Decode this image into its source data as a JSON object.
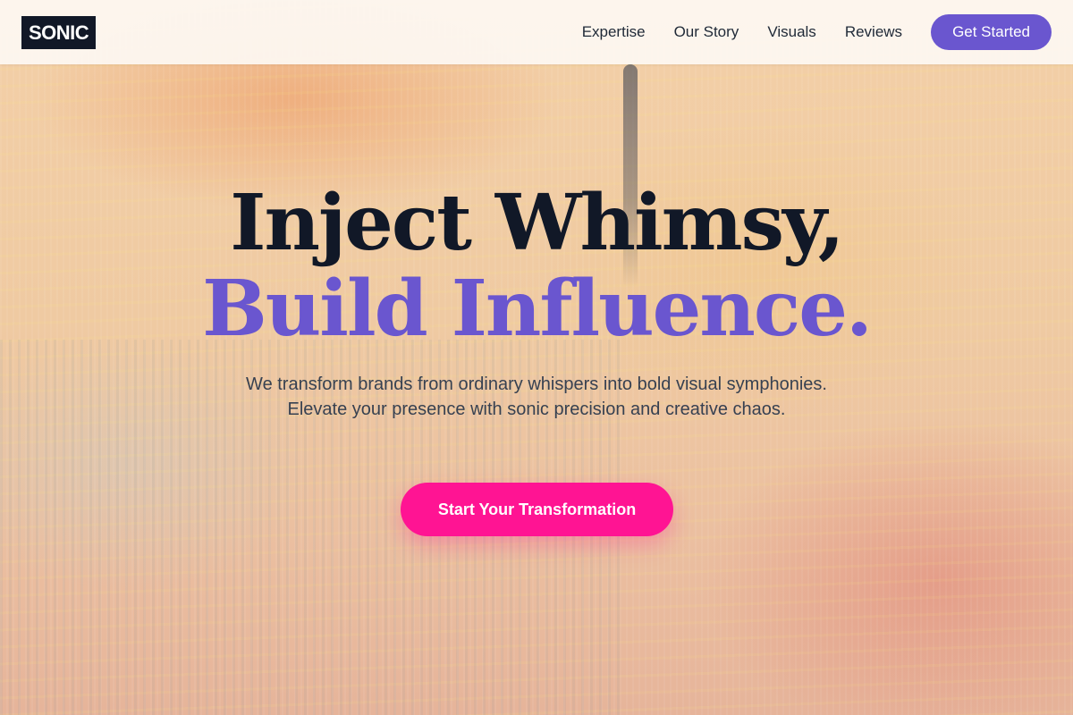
{
  "brand": {
    "logo_text": "SONIC"
  },
  "nav": {
    "items": [
      {
        "label": "Expertise"
      },
      {
        "label": "Our Story"
      },
      {
        "label": "Visuals"
      },
      {
        "label": "Reviews"
      }
    ],
    "cta_label": "Get Started"
  },
  "hero": {
    "headline_line1": "Inject Whimsy,",
    "headline_line2": "Build Influence.",
    "subtitle": "We transform brands from ordinary whispers into bold visual symphonies. Elevate your presence with sonic precision and creative chaos.",
    "cta_label": "Start Your Transformation"
  },
  "colors": {
    "brand_dark": "#111827",
    "accent_purple": "#6a56cf",
    "cta_pink": "#ff1493"
  }
}
